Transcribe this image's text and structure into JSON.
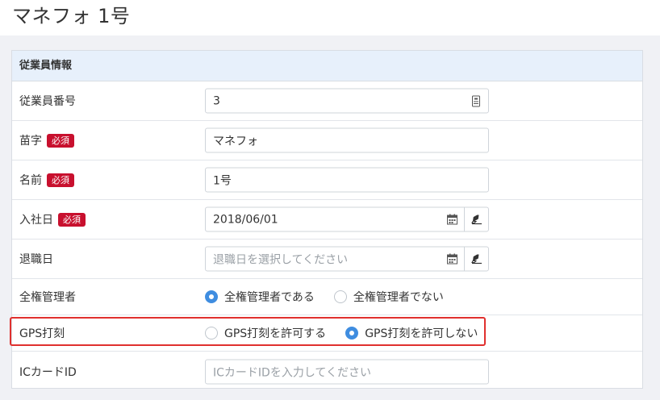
{
  "header": {
    "title": "マネフォ 1号"
  },
  "card": {
    "title": "従業員情報"
  },
  "rows": {
    "employee_number": {
      "label": "従業員番号",
      "value": "3"
    },
    "last_name": {
      "label": "苗字",
      "required": "必須",
      "value": "マネフォ"
    },
    "first_name": {
      "label": "名前",
      "required": "必須",
      "value": "1号"
    },
    "join_date": {
      "label": "入社日",
      "required": "必須",
      "value": "2018/06/01"
    },
    "leave_date": {
      "label": "退職日",
      "placeholder": "退職日を選択してください"
    },
    "full_admin": {
      "label": "全権管理者",
      "options": [
        "全権管理者である",
        "全権管理者でない"
      ],
      "selected": 0
    },
    "gps": {
      "label": "GPS打刻",
      "options": [
        "GPS打刻を許可する",
        "GPS打刻を許可しない"
      ],
      "selected": 1
    },
    "ic_card": {
      "label": "ICカードID",
      "placeholder": "ICカードIDを入力してください"
    }
  },
  "colors": {
    "accent": "#3f8de0",
    "required_badge": "#c8102e",
    "highlight": "#e0302e",
    "card_header": "#e7f0fb"
  }
}
